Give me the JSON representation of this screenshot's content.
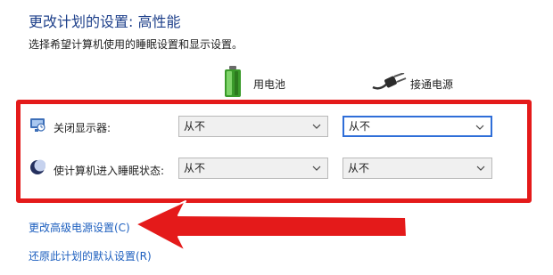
{
  "page": {
    "title": "更改计划的设置: 高性能",
    "subtitle": "选择希望计算机使用的睡眠设置和显示设置。"
  },
  "columns": {
    "battery_label": "用电池",
    "plugged_label": "接通电源"
  },
  "rows": [
    {
      "label": "关闭显示器:",
      "battery_value": "从不",
      "plugged_value": "从不"
    },
    {
      "label": "使计算机进入睡眠状态:",
      "battery_value": "从不",
      "plugged_value": "从不"
    }
  ],
  "links": {
    "advanced": "更改高级电源设置(C)",
    "restore": "还原此计划的默认设置(R)"
  },
  "colors": {
    "highlight_frame": "#e41a1a",
    "arrow": "#e41a1a",
    "link": "#1d5fbf",
    "title": "#1d3f8a"
  },
  "icons": {
    "battery": "battery-icon",
    "plug": "plug-icon",
    "display": "monitor-icon",
    "sleep": "moon-icon"
  }
}
